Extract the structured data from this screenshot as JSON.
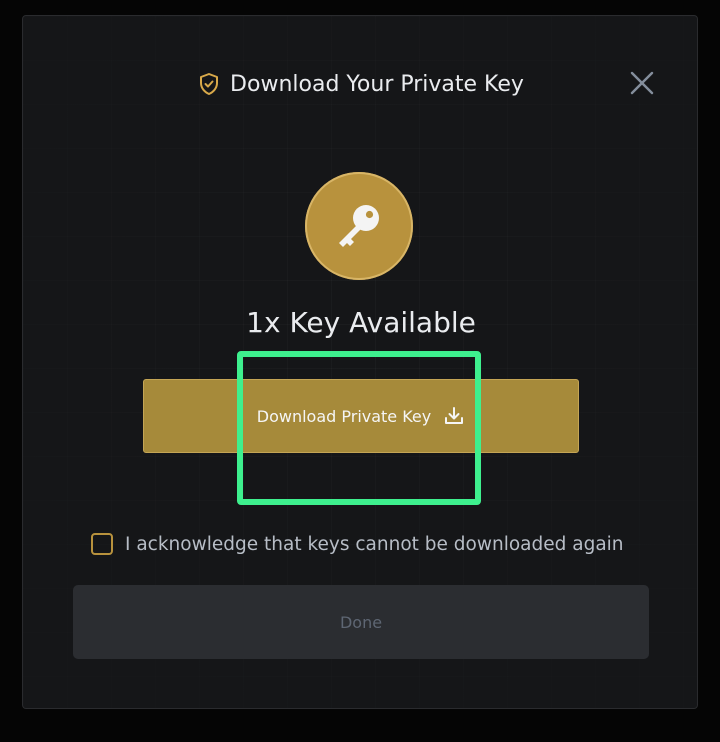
{
  "dialog": {
    "title": "Download Your Private Key",
    "title_icon": "shield-check-icon",
    "close_icon": "close-icon"
  },
  "key_badge": {
    "icon": "key-icon"
  },
  "availability": {
    "text": "1x Key Available"
  },
  "download": {
    "label": "Download Private Key",
    "icon": "download-icon"
  },
  "acknowledge": {
    "label": "I acknowledge that keys cannot be downloaded again",
    "checked": false
  },
  "done": {
    "label": "Done",
    "enabled": false
  },
  "colors": {
    "accent_gold": "#a68a3a",
    "badge_gold": "#b8923d",
    "highlight_green": "#3ef08e",
    "panel_background": "#151618",
    "done_background": "#2b2d31"
  }
}
